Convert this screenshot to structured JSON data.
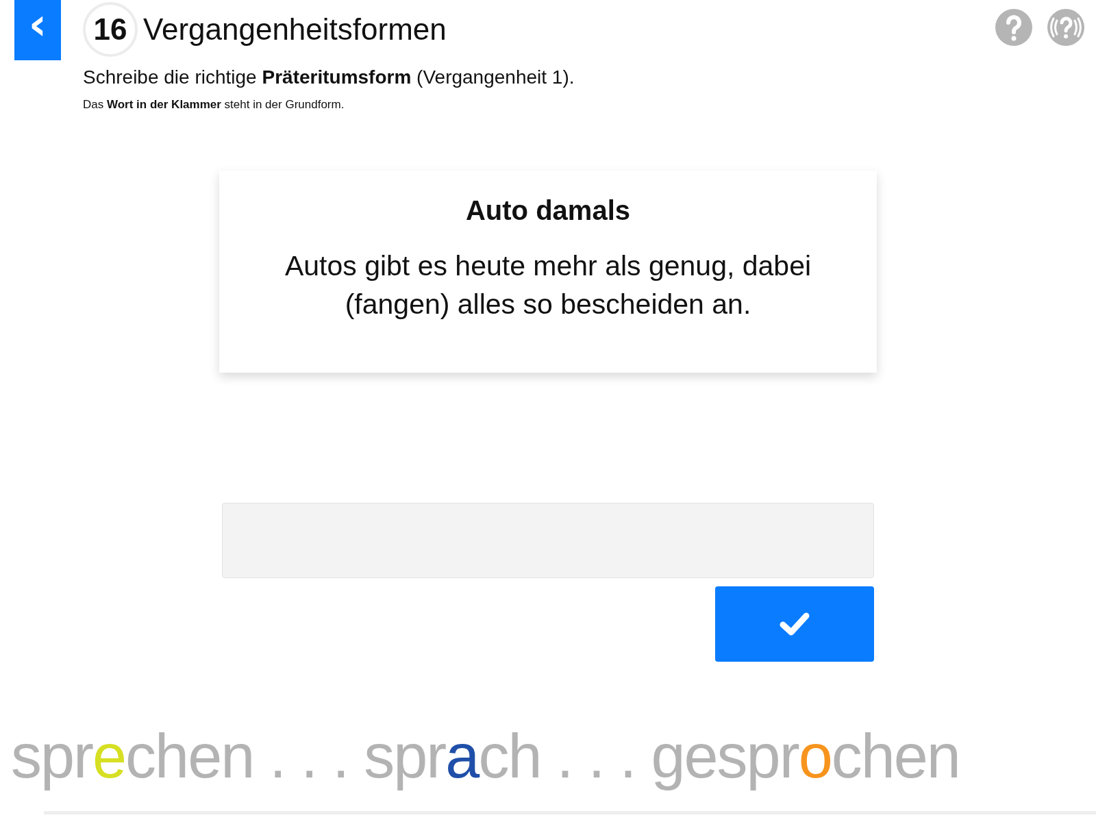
{
  "header": {
    "back_button": "‹",
    "number": "16",
    "title": "Vergangenheitsformen",
    "instruction": "Schreibe die richtige **Präteritumsform** (Vergangenheit 1).",
    "note": "Das **Wort in der Klammer** steht in der Grundform.",
    "help_buttons": [
      {
        "kind": "help"
      },
      {
        "kind": "audio-help"
      }
    ]
  },
  "card": {
    "title": "Auto damals",
    "text": "Autos gibt es heute mehr als genug, dabei (fangen) alles so bescheiden an."
  },
  "footer": {
    "segments": [
      {
        "text": "spr",
        "color": "#b3b3b3"
      },
      {
        "text": "e",
        "color": "#d6df22"
      },
      {
        "text": "chen . . . spr",
        "color": "#b3b3b3"
      },
      {
        "text": "a",
        "color": "#1f4fa8"
      },
      {
        "text": "ch . . . gespr",
        "color": "#b3b3b3"
      },
      {
        "text": "o",
        "color": "#f7941d"
      },
      {
        "text": "chen",
        "color": "#b3b3b3"
      }
    ]
  }
}
